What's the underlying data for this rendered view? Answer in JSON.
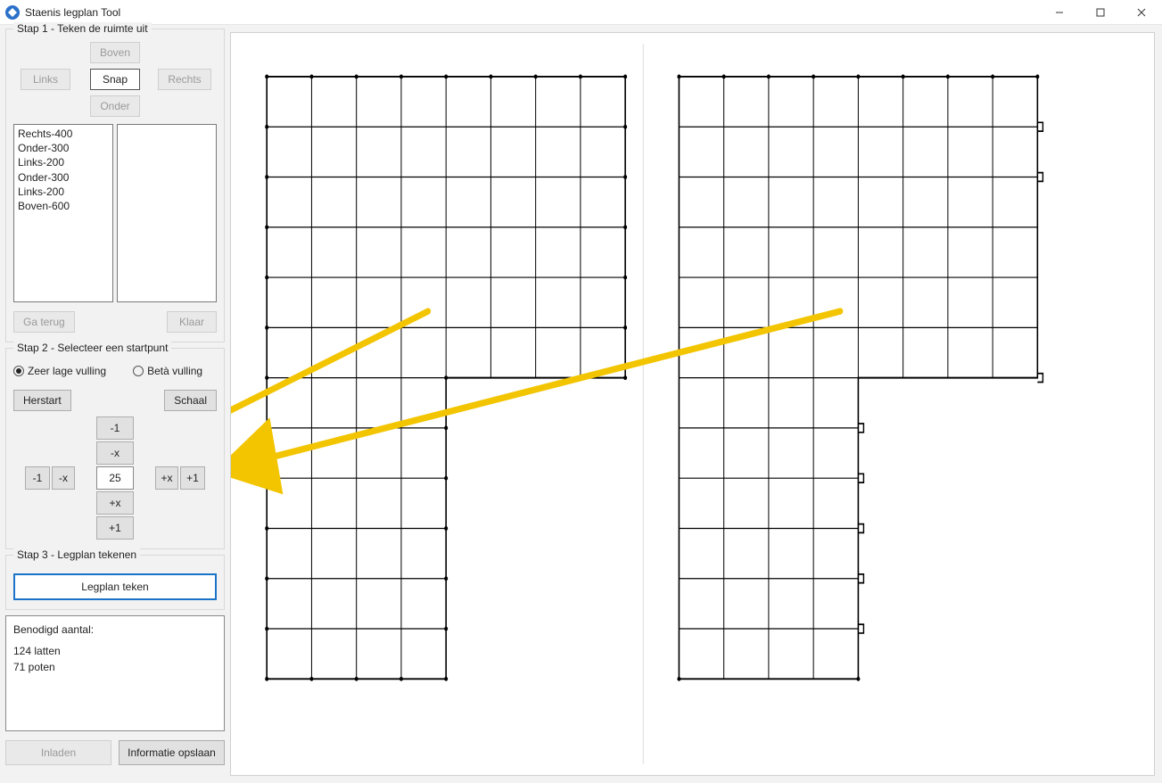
{
  "window": {
    "title": "Staenis legplan Tool"
  },
  "step1": {
    "legend": "Stap 1 - Teken de ruimte uit",
    "boven": "Boven",
    "links": "Links",
    "snap": "Snap",
    "rechts": "Rechts",
    "onder": "Onder",
    "history": [
      "Rechts-400",
      "Onder-300",
      "Links-200",
      "Onder-300",
      "Links-200",
      "Boven-600"
    ],
    "ga_terug": "Ga terug",
    "klaar": "Klaar"
  },
  "step2": {
    "legend": "Stap 2 - Selecteer een startpunt",
    "radio1": "Zeer lage vulling",
    "radio2": "Betà vulling",
    "herstart": "Herstart",
    "schaal": "Schaal",
    "minus1_top": "-1",
    "minusx_top": "-x",
    "minus1_left": "-1",
    "minusx_left": "-x",
    "value": "25",
    "plusx_right": "+x",
    "plus1_right": "+1",
    "plusx_bot": "+x",
    "plus1_bot": "+1"
  },
  "step3": {
    "legend": "Stap 3 - Legplan tekenen",
    "draw": "Legplan teken"
  },
  "results": {
    "heading": "Benodigd aantal:",
    "line1": "124 latten",
    "line2": "71 poten"
  },
  "footer": {
    "inladen": "Inladen",
    "opslaan": "Informatie opslaan"
  }
}
